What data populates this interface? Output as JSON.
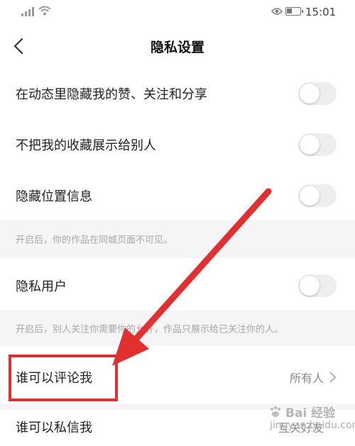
{
  "status_bar": {
    "time": "15:01"
  },
  "header": {
    "title": "隐私设置"
  },
  "settings": [
    {
      "label": "在动态里隐藏我的赞、关注和分享",
      "on": false
    },
    {
      "label": "不把我的收藏展示给别人",
      "on": false
    },
    {
      "label": "隐藏位置信息",
      "on": false
    },
    {
      "label": "隐私用户",
      "on": false
    }
  ],
  "hints": {
    "location": "开启后，你的作品在同城页面不可见。",
    "private_user": "开启后，别人关注你需要你的允许，作品只展示给已关注你的人。"
  },
  "comment_setting": {
    "label": "谁可以评论我",
    "value": "所有人"
  },
  "message_setting": {
    "label": "谁可以私信我",
    "value": "互关好友"
  },
  "watermark": {
    "brand": "Bai 经验",
    "url": "jingyan.baidu.com"
  },
  "colors": {
    "annotation_red": "#e23030",
    "hint_bg": "#f5f5f5"
  }
}
